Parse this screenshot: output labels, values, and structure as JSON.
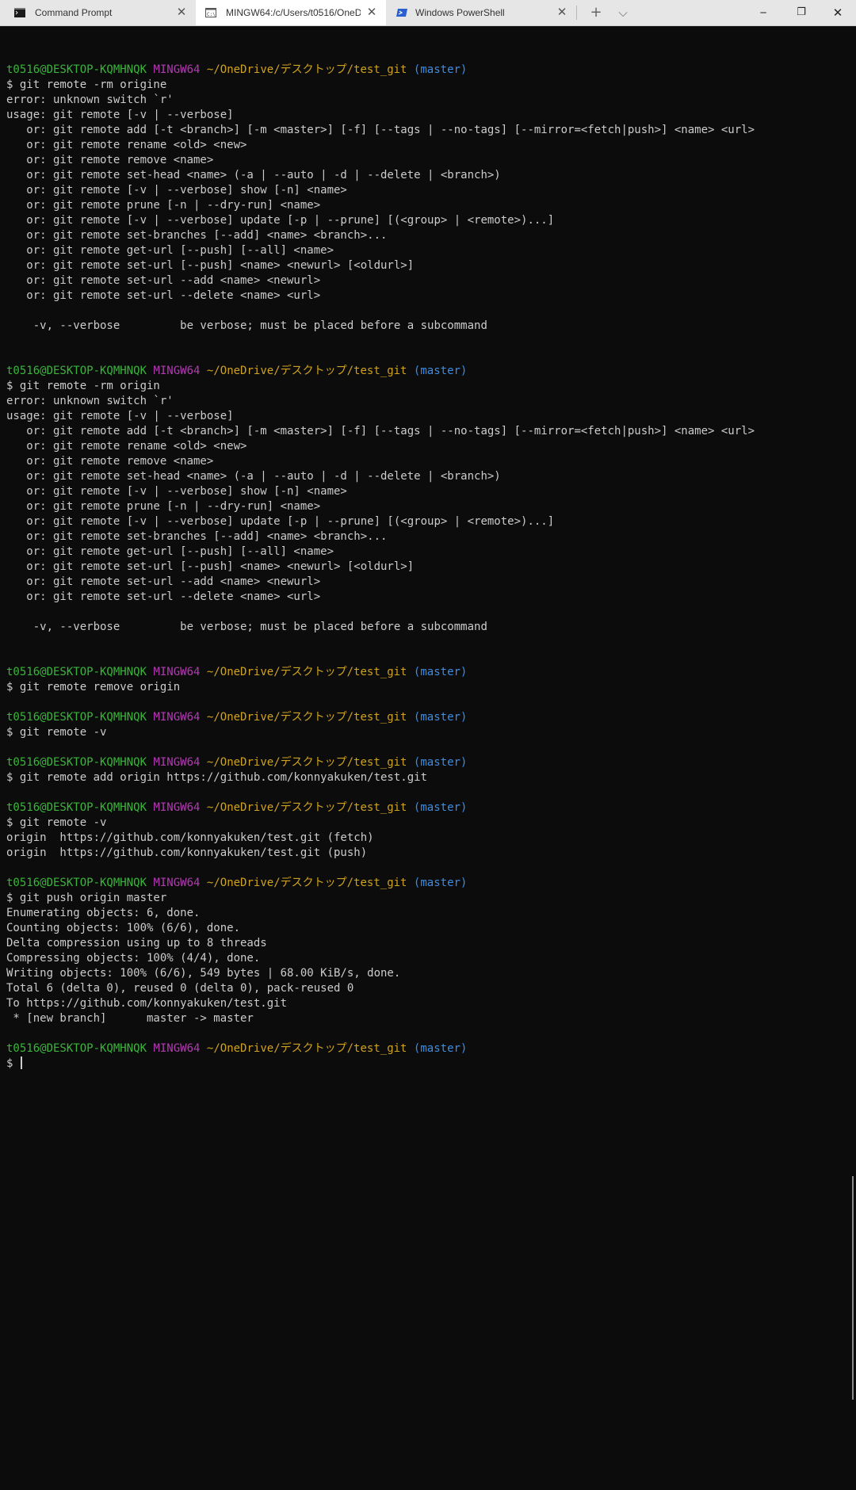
{
  "tabs": [
    {
      "label": "Command Prompt",
      "icon": "cmd-icon",
      "active": false
    },
    {
      "label": "MINGW64:/c/Users/t0516/OneD",
      "icon": "mingw-icon",
      "active": true
    },
    {
      "label": "Windows PowerShell",
      "icon": "powershell-icon",
      "active": false
    }
  ],
  "tab_controls": {
    "close_glyph": "✕",
    "new_tab_glyph": "+",
    "dropdown_glyph": "⌵"
  },
  "window_controls": {
    "minimize": "─",
    "maximize": "❐",
    "close": "✕"
  },
  "prompt": {
    "user": "t0516@DESKTOP-KQMHNQK",
    "system": "MINGW64",
    "path": "~/OneDrive/デスクトップ/test_git",
    "branch": "(master)"
  },
  "colors": {
    "background": "#0c0c0c",
    "text": "#cccccc",
    "user": "#3ab53a",
    "system": "#b43ab4",
    "path": "#cfa31f",
    "branch": "#3b8ee6"
  },
  "terminal": [
    {
      "type": "prompt"
    },
    {
      "type": "text",
      "text": "$ git remote -rm origine"
    },
    {
      "type": "text",
      "text": "error: unknown switch `r'"
    },
    {
      "type": "text",
      "text": "usage: git remote [-v | --verbose]"
    },
    {
      "type": "text",
      "text": "   or: git remote add [-t <branch>] [-m <master>] [-f] [--tags | --no-tags] [--mirror=<fetch|push>] <name> <url>"
    },
    {
      "type": "text",
      "text": "   or: git remote rename <old> <new>"
    },
    {
      "type": "text",
      "text": "   or: git remote remove <name>"
    },
    {
      "type": "text",
      "text": "   or: git remote set-head <name> (-a | --auto | -d | --delete | <branch>)"
    },
    {
      "type": "text",
      "text": "   or: git remote [-v | --verbose] show [-n] <name>"
    },
    {
      "type": "text",
      "text": "   or: git remote prune [-n | --dry-run] <name>"
    },
    {
      "type": "text",
      "text": "   or: git remote [-v | --verbose] update [-p | --prune] [(<group> | <remote>)...]"
    },
    {
      "type": "text",
      "text": "   or: git remote set-branches [--add] <name> <branch>..."
    },
    {
      "type": "text",
      "text": "   or: git remote get-url [--push] [--all] <name>"
    },
    {
      "type": "text",
      "text": "   or: git remote set-url [--push] <name> <newurl> [<oldurl>]"
    },
    {
      "type": "text",
      "text": "   or: git remote set-url --add <name> <newurl>"
    },
    {
      "type": "text",
      "text": "   or: git remote set-url --delete <name> <url>"
    },
    {
      "type": "text",
      "text": ""
    },
    {
      "type": "text",
      "text": "    -v, --verbose         be verbose; must be placed before a subcommand"
    },
    {
      "type": "text",
      "text": ""
    },
    {
      "type": "text",
      "text": ""
    },
    {
      "type": "prompt"
    },
    {
      "type": "text",
      "text": "$ git remote -rm origin"
    },
    {
      "type": "text",
      "text": "error: unknown switch `r'"
    },
    {
      "type": "text",
      "text": "usage: git remote [-v | --verbose]"
    },
    {
      "type": "text",
      "text": "   or: git remote add [-t <branch>] [-m <master>] [-f] [--tags | --no-tags] [--mirror=<fetch|push>] <name> <url>"
    },
    {
      "type": "text",
      "text": "   or: git remote rename <old> <new>"
    },
    {
      "type": "text",
      "text": "   or: git remote remove <name>"
    },
    {
      "type": "text",
      "text": "   or: git remote set-head <name> (-a | --auto | -d | --delete | <branch>)"
    },
    {
      "type": "text",
      "text": "   or: git remote [-v | --verbose] show [-n] <name>"
    },
    {
      "type": "text",
      "text": "   or: git remote prune [-n | --dry-run] <name>"
    },
    {
      "type": "text",
      "text": "   or: git remote [-v | --verbose] update [-p | --prune] [(<group> | <remote>)...]"
    },
    {
      "type": "text",
      "text": "   or: git remote set-branches [--add] <name> <branch>..."
    },
    {
      "type": "text",
      "text": "   or: git remote get-url [--push] [--all] <name>"
    },
    {
      "type": "text",
      "text": "   or: git remote set-url [--push] <name> <newurl> [<oldurl>]"
    },
    {
      "type": "text",
      "text": "   or: git remote set-url --add <name> <newurl>"
    },
    {
      "type": "text",
      "text": "   or: git remote set-url --delete <name> <url>"
    },
    {
      "type": "text",
      "text": ""
    },
    {
      "type": "text",
      "text": "    -v, --verbose         be verbose; must be placed before a subcommand"
    },
    {
      "type": "text",
      "text": ""
    },
    {
      "type": "text",
      "text": ""
    },
    {
      "type": "prompt"
    },
    {
      "type": "text",
      "text": "$ git remote remove origin"
    },
    {
      "type": "text",
      "text": ""
    },
    {
      "type": "prompt"
    },
    {
      "type": "text",
      "text": "$ git remote -v"
    },
    {
      "type": "text",
      "text": ""
    },
    {
      "type": "prompt"
    },
    {
      "type": "text",
      "text": "$ git remote add origin https://github.com/konnyakuken/test.git"
    },
    {
      "type": "text",
      "text": ""
    },
    {
      "type": "prompt"
    },
    {
      "type": "text",
      "text": "$ git remote -v"
    },
    {
      "type": "text",
      "text": "origin  https://github.com/konnyakuken/test.git (fetch)"
    },
    {
      "type": "text",
      "text": "origin  https://github.com/konnyakuken/test.git (push)"
    },
    {
      "type": "text",
      "text": ""
    },
    {
      "type": "prompt"
    },
    {
      "type": "text",
      "text": "$ git push origin master"
    },
    {
      "type": "text",
      "text": "Enumerating objects: 6, done."
    },
    {
      "type": "text",
      "text": "Counting objects: 100% (6/6), done."
    },
    {
      "type": "text",
      "text": "Delta compression using up to 8 threads"
    },
    {
      "type": "text",
      "text": "Compressing objects: 100% (4/4), done."
    },
    {
      "type": "text",
      "text": "Writing objects: 100% (6/6), 549 bytes | 68.00 KiB/s, done."
    },
    {
      "type": "text",
      "text": "Total 6 (delta 0), reused 0 (delta 0), pack-reused 0"
    },
    {
      "type": "text",
      "text": "To https://github.com/konnyakuken/test.git"
    },
    {
      "type": "text",
      "text": " * [new branch]      master -> master"
    },
    {
      "type": "text",
      "text": ""
    },
    {
      "type": "prompt"
    },
    {
      "type": "input",
      "text": "$ "
    }
  ]
}
